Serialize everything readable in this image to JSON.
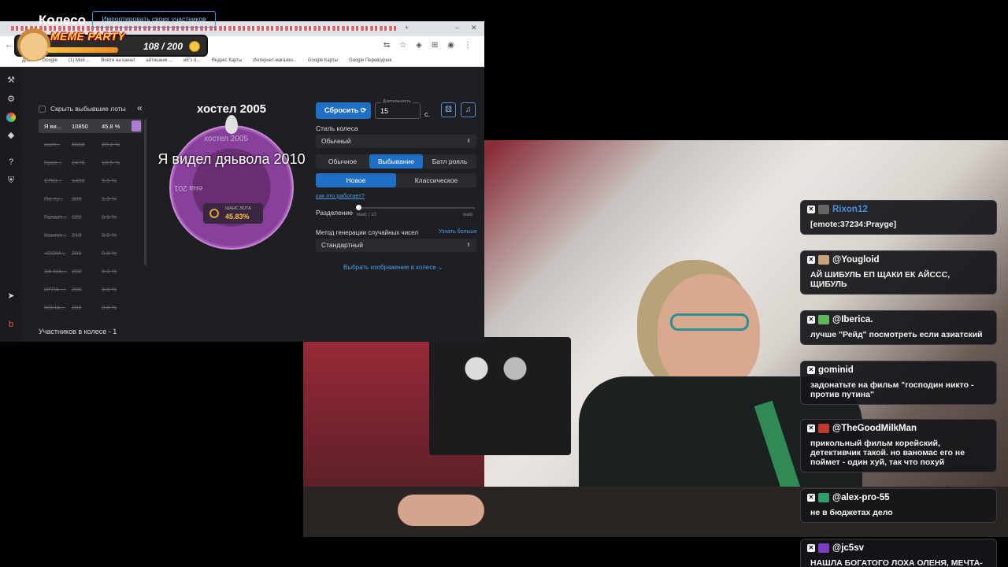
{
  "meme_party": {
    "logo": "MEME PARTY",
    "count": "108 / 200"
  },
  "bookmarks": [
    "Дом",
    "Google",
    "(1) Мой ...",
    "Войти на канал",
    "айтишник ...",
    "еЕ's d...",
    "Яндекс Карты",
    "Интернет-магазин...",
    "Google Карты",
    "Google Переводчик"
  ],
  "app": {
    "title": "Колесо",
    "import_button": "Импортировать своих участников",
    "hide_label": "Скрыть выбывшие лоты",
    "collapse": "«",
    "lots": [
      {
        "name": "Я ви...",
        "amount": "10850",
        "pct": "45.8 %"
      },
      {
        "name": "хост...",
        "amount": "6666",
        "pct": "28.2 %"
      },
      {
        "name": "Крас...",
        "amount": "2476",
        "pct": "10.5 %"
      },
      {
        "name": "СПО...",
        "amount": "1400",
        "pct": "5.9 %"
      },
      {
        "name": "По ту...",
        "amount": "300",
        "pct": "1.3 %"
      },
      {
        "name": "Галакт...",
        "amount": "222",
        "pct": "0.9 %"
      },
      {
        "name": "Компл...",
        "amount": "210",
        "pct": "0.9 %"
      },
      {
        "name": "«БОМ...",
        "amount": "200",
        "pct": "0.8 %"
      },
      {
        "name": "ЗА МА...",
        "amount": "200",
        "pct": "0.8 %"
      },
      {
        "name": "ИГРА-...",
        "amount": "200",
        "pct": "0.8 %"
      },
      {
        "name": "КОНА...",
        "amount": "200",
        "pct": "0.8 %"
      }
    ],
    "participants_count": "Участников в колесе - 1",
    "winner_title": "хостел 2005",
    "wheel_text": "Я видел дяьвола 2010",
    "wheel_ghost_top": "хостел 2005",
    "wheel_ghost_left": "ена 201",
    "chance_label": "ШАНС ЛОТА",
    "chance_value": "45.83%",
    "spin_button": "Сбросить",
    "duration_label": "Длительность",
    "duration_value": "15",
    "duration_unit": "с.",
    "style_label": "Стиль колеса",
    "style_value": "Обычный",
    "modes": [
      "Обычное",
      "Выбывание",
      "Батл рояль"
    ],
    "elim_modes": [
      "Новое",
      "Классическое"
    ],
    "how_link": "как это работает?",
    "separation_label": "Разделение",
    "slider_min": "макс / 10",
    "slider_max": "макс",
    "rng_label": "Метод генерации случайных чисел",
    "rng_more": "Узнать больше",
    "rng_value": "Стандартный",
    "pick_image": "Выбрать изображение в колесе"
  },
  "chat": [
    {
      "user": "Rixon12",
      "color": "#4a8fe0",
      "text": "[emote:37234:Prayge]"
    },
    {
      "user": "@Yougloid",
      "color": "#ffffff",
      "text": "АЙ ШИБУЛЬ ЕП ЩАКИ ЕК АЙССС, ЩИБУЛЬ"
    },
    {
      "user": "@Iberica.",
      "color": "#ffffff",
      "text": "лучше \"Рейд\" посмотреть если азиатский"
    },
    {
      "user": "gominid",
      "color": "#ffffff",
      "text": "задонатьте на фильм \"господин никто - против путина\""
    },
    {
      "user": "@TheGoodMilkMan",
      "color": "#ffffff",
      "text": "прикольный фильм корейский, детективчик такой. но ваномас его не поймет - один хуй, так что похуй"
    },
    {
      "user": "@alex-pro-55",
      "color": "#ffffff",
      "text": "не в бюджетах дело"
    },
    {
      "user": "@jc5sv",
      "color": "#ffffff",
      "text": "НАШЛА БОГАТОГО ЛОХА ОЛЕНЯ, МЕЧТА-"
    }
  ]
}
